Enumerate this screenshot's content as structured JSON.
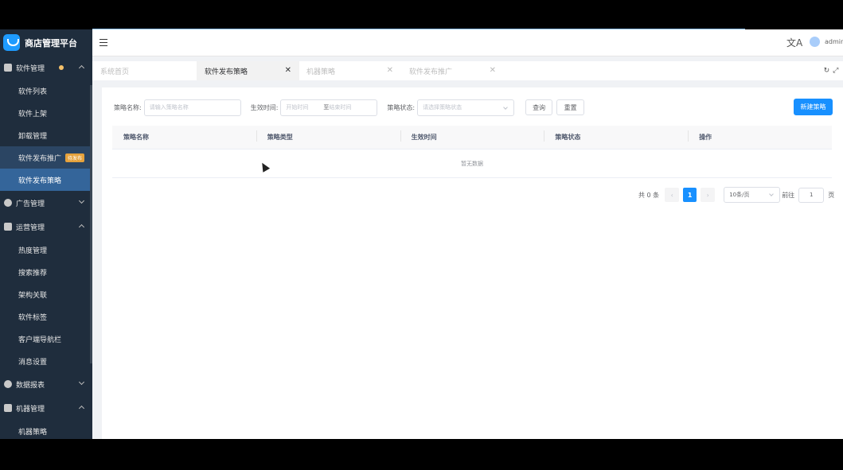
{
  "app": {
    "title": "商店管理平台"
  },
  "sidebar": {
    "groups": [
      {
        "label": "软件管理",
        "expanded": true,
        "icon": "box-icon",
        "items": [
          {
            "label": "软件列表"
          },
          {
            "label": "软件上架"
          },
          {
            "label": "卸载管理"
          },
          {
            "label": "软件发布推广",
            "badge": "待发布"
          },
          {
            "label": "软件发布策略",
            "active": true
          }
        ]
      },
      {
        "label": "广告管理",
        "expanded": false,
        "icon": "ad-icon"
      },
      {
        "label": "运营管理",
        "expanded": true,
        "icon": "book-icon",
        "items": [
          {
            "label": "热度管理"
          },
          {
            "label": "搜索推荐"
          },
          {
            "label": "架构关联"
          },
          {
            "label": "软件标签"
          },
          {
            "label": "客户端导航栏"
          },
          {
            "label": "消息设置"
          }
        ]
      },
      {
        "label": "数据报表",
        "expanded": false,
        "icon": "chart-icon"
      },
      {
        "label": "机器管理",
        "expanded": true,
        "icon": "server-icon",
        "items": [
          {
            "label": "机器策略"
          }
        ]
      }
    ]
  },
  "header": {
    "username": "admin",
    "translate_glyph": "文A"
  },
  "tabs": [
    {
      "label": "系统首页",
      "closable": false
    },
    {
      "label": "软件发布策略",
      "active": true
    },
    {
      "label": "机器策略"
    },
    {
      "label": "软件发布推广"
    }
  ],
  "filters": {
    "name_label": "策略名称:",
    "name_placeholder": "请输入策略名称",
    "time_label": "生效时间:",
    "start_placeholder": "开始时间",
    "range_sep": "至",
    "end_placeholder": "结束时间",
    "status_label": "策略状态:",
    "status_placeholder": "请选择策略状态",
    "query_button": "查询",
    "reset_button": "重置",
    "create_button": "新建策略"
  },
  "table": {
    "columns": [
      "策略名称",
      "策略类型",
      "生效时间",
      "策略状态",
      "操作"
    ],
    "empty_text": "暂无数据"
  },
  "pagination": {
    "total_text": "共 0 条",
    "current_page": "1",
    "page_size": "10条/页",
    "goto_label": "前往",
    "goto_value": "1",
    "page_unit": "页"
  }
}
